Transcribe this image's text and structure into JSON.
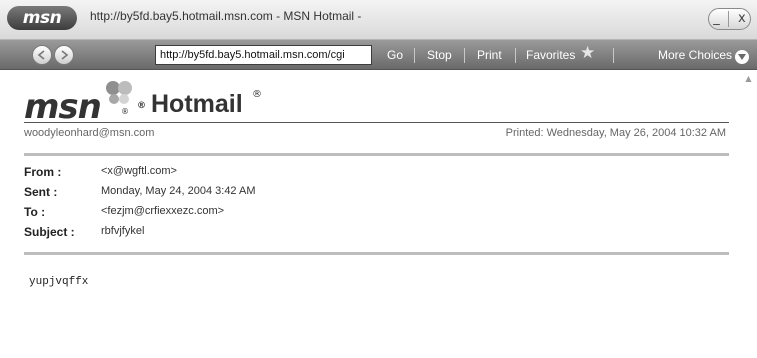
{
  "window": {
    "logo": "msn",
    "title": "http://by5fd.bay5.hotmail.msn.com - MSN Hotmail -",
    "minimize": "_",
    "close": "x"
  },
  "toolbar": {
    "address": "http://by5fd.bay5.hotmail.msn.com/cgi",
    "go": "Go",
    "stop": "Stop",
    "print": "Print",
    "favorites": "Favorites",
    "more_choices": "More Choices"
  },
  "header": {
    "logo": "msn",
    "title": "Hotmail",
    "user_email": "woodyleonhard@msn.com",
    "printed": "Printed: Wednesday, May 26, 2004 10:32 AM"
  },
  "message": {
    "from_label": "From :",
    "from": "<x@wgftl.com>",
    "sent_label": "Sent :",
    "sent": "Monday, May 24, 2004 3:42 AM",
    "to_label": "To :",
    "to": "<fezjm@crfiexxezc.com>",
    "subject_label": "Subject :",
    "subject": "rbfvjfykel",
    "body": "yupjvqffx"
  },
  "colors": {
    "toolbar": "#7d7d7d",
    "divider": "#bdbdbd"
  }
}
